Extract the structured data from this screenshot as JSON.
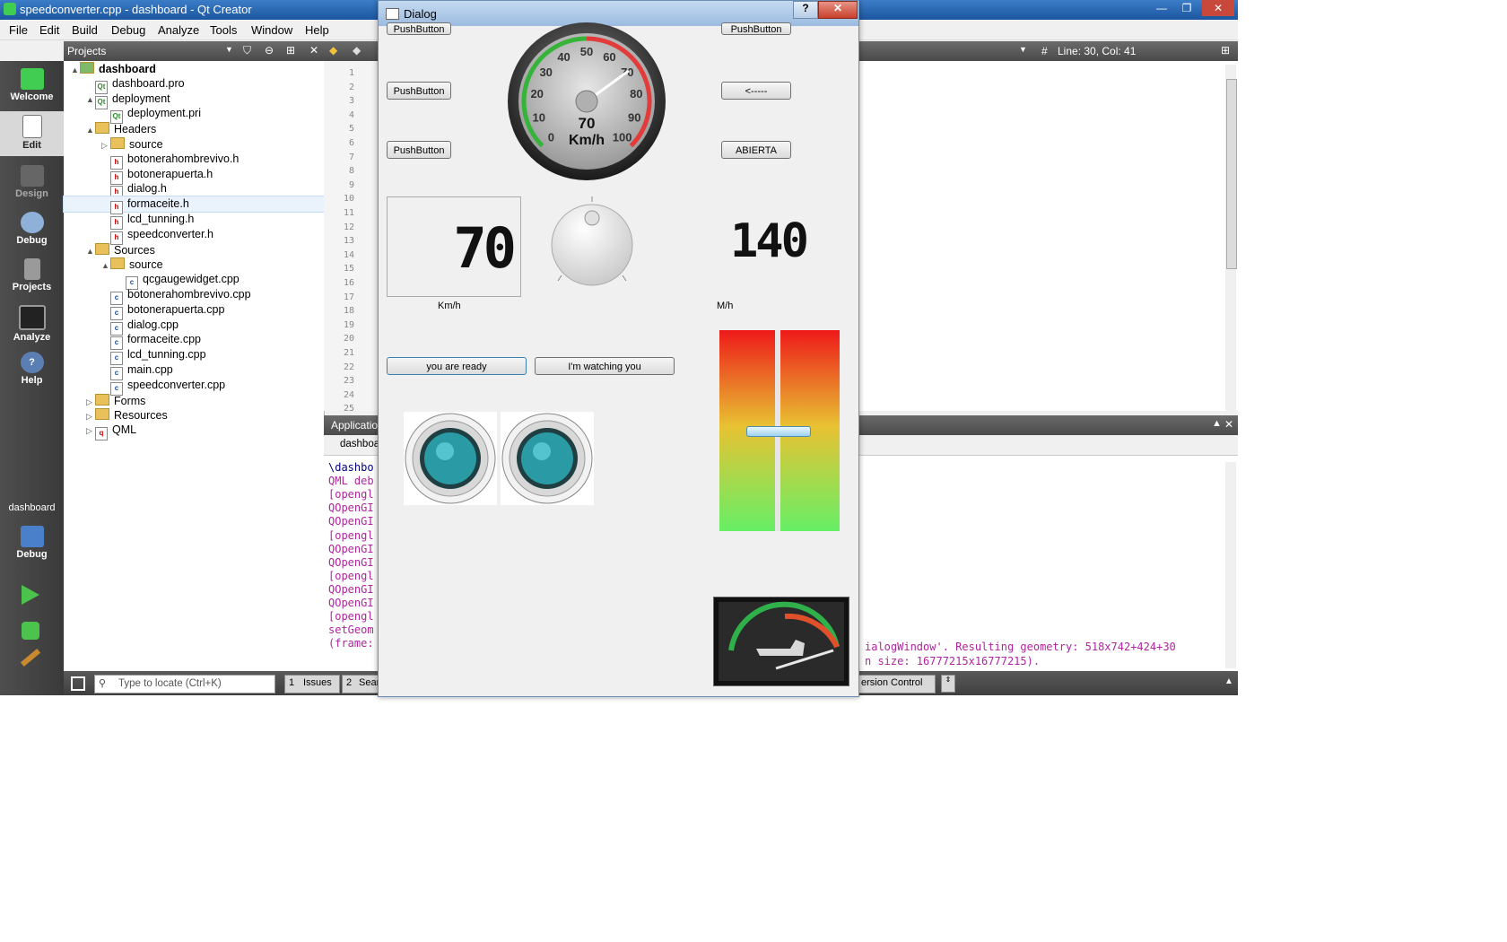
{
  "qt": {
    "title": "speedconverter.cpp - dashboard - Qt Creator",
    "menu": [
      "File",
      "Edit",
      "Build",
      "Debug",
      "Analyze",
      "Tools",
      "Window",
      "Help"
    ],
    "modes": [
      {
        "label": "Welcome",
        "icon": "qt-logo-icon"
      },
      {
        "label": "Edit",
        "icon": "edit-document-icon"
      },
      {
        "label": "Design",
        "icon": "design-pencil-icon"
      },
      {
        "label": "Debug",
        "icon": "debug-bug-icon"
      },
      {
        "label": "Projects",
        "icon": "projects-icon"
      },
      {
        "label": "Analyze",
        "icon": "analyze-monitor-icon"
      },
      {
        "label": "Help",
        "icon": "help-icon"
      }
    ],
    "kit": {
      "project": "dashboard",
      "mode": "Debug"
    },
    "projects_label": "Projects",
    "tree": [
      {
        "label": "dashboard",
        "depth": 0,
        "kind": "project",
        "bold": true,
        "arrow": "▲"
      },
      {
        "label": "dashboard.pro",
        "depth": 1,
        "kind": "pro",
        "arrow": ""
      },
      {
        "label": "deployment",
        "depth": 1,
        "kind": "pro",
        "arrow": "▲"
      },
      {
        "label": "deployment.pri",
        "depth": 2,
        "kind": "pro",
        "arrow": ""
      },
      {
        "label": "Headers",
        "depth": 1,
        "kind": "folder-h",
        "arrow": "▲"
      },
      {
        "label": "source",
        "depth": 2,
        "kind": "folder",
        "arrow": "▷"
      },
      {
        "label": "botonerahombrevivo.h",
        "depth": 2,
        "kind": "h",
        "arrow": ""
      },
      {
        "label": "botonerapuerta.h",
        "depth": 2,
        "kind": "h",
        "arrow": ""
      },
      {
        "label": "dialog.h",
        "depth": 2,
        "kind": "h",
        "arrow": ""
      },
      {
        "label": "formaceite.h",
        "depth": 2,
        "kind": "h",
        "arrow": "",
        "selected": true
      },
      {
        "label": "lcd_tunning.h",
        "depth": 2,
        "kind": "h",
        "arrow": ""
      },
      {
        "label": "speedconverter.h",
        "depth": 2,
        "kind": "h",
        "arrow": ""
      },
      {
        "label": "Sources",
        "depth": 1,
        "kind": "folder",
        "arrow": "▲"
      },
      {
        "label": "source",
        "depth": 2,
        "kind": "folder",
        "arrow": "▲"
      },
      {
        "label": "qcgaugewidget.cpp",
        "depth": 3,
        "kind": "cpp",
        "arrow": ""
      },
      {
        "label": "botonerahombrevivo.cpp",
        "depth": 2,
        "kind": "cpp",
        "arrow": ""
      },
      {
        "label": "botonerapuerta.cpp",
        "depth": 2,
        "kind": "cpp",
        "arrow": ""
      },
      {
        "label": "dialog.cpp",
        "depth": 2,
        "kind": "cpp",
        "arrow": ""
      },
      {
        "label": "formaceite.cpp",
        "depth": 2,
        "kind": "cpp",
        "arrow": ""
      },
      {
        "label": "lcd_tunning.cpp",
        "depth": 2,
        "kind": "cpp",
        "arrow": ""
      },
      {
        "label": "main.cpp",
        "depth": 2,
        "kind": "cpp",
        "arrow": ""
      },
      {
        "label": "speedconverter.cpp",
        "depth": 2,
        "kind": "cpp",
        "arrow": ""
      },
      {
        "label": "Forms",
        "depth": 1,
        "kind": "folder",
        "arrow": "▷"
      },
      {
        "label": "Resources",
        "depth": 1,
        "kind": "folder",
        "arrow": "▷"
      },
      {
        "label": "QML",
        "depth": 1,
        "kind": "qml",
        "arrow": "▷"
      }
    ],
    "editor": {
      "cursor": "Line: 30, Col: 41",
      "hash": "#",
      "line_numbers": [
        "1",
        "2",
        "3",
        "4",
        "5",
        "6",
        "7",
        "8",
        "9",
        "10",
        "11",
        "12",
        "13",
        "14",
        "15",
        "16",
        "17",
        "18",
        "19",
        "20",
        "21",
        "22",
        "23",
        "24",
        "25"
      ]
    },
    "output": {
      "pane_title": "Application",
      "tab": "dashboard",
      "lines": [
        {
          "text": "\\dashbo",
          "color": "#000080"
        },
        {
          "text": "QML deb",
          "color": "#b0249f"
        },
        {
          "text": "[opengl",
          "color": "#b0249f"
        },
        {
          "text": "QOpenGI",
          "color": "#b0249f"
        },
        {
          "text": "QOpenGI",
          "color": "#b0249f"
        },
        {
          "text": "[opengl",
          "color": "#b0249f"
        },
        {
          "text": "QOpenGI",
          "color": "#b0249f"
        },
        {
          "text": "QOpenGI",
          "color": "#b0249f"
        },
        {
          "text": "[opengl",
          "color": "#b0249f"
        },
        {
          "text": "QOpenGI",
          "color": "#b0249f"
        },
        {
          "text": "QOpenGI",
          "color": "#b0249f"
        },
        {
          "text": "[opengl",
          "color": "#b0249f"
        },
        {
          "text": "setGeom",
          "color": "#b0249f"
        },
        {
          "text": "(frame:",
          "color": "#b0249f"
        }
      ],
      "right_line1": "ialogWindow'. Resulting geometry:  518x742+424+30",
      "right_line2": "n size: 16777215x16777215)."
    },
    "status": {
      "locator_placeholder": "Type to locate (Ctrl+K)",
      "tabs": [
        {
          "num": "1",
          "label": "Issues"
        },
        {
          "num": "2",
          "label": "Sear"
        }
      ],
      "right_tab": "ersion Control"
    }
  },
  "dialog": {
    "title": "Dialog",
    "help_btn": "?",
    "close_btn": "✕",
    "buttons_left": [
      "PushButton",
      "PushButton",
      "PushButton"
    ],
    "buttons_right": [
      "PushButton",
      "<-----",
      "ABIERTA"
    ],
    "gauge": {
      "value": 70,
      "unit": "Km/h",
      "ticks": [
        "0",
        "10",
        "20",
        "30",
        "40",
        "50",
        "60",
        "70",
        "80",
        "90",
        "100"
      ]
    },
    "lcd_kmh": "70",
    "lcd_mph": "140",
    "label_kmh": "Km/h",
    "label_mph": "M/h",
    "btn_ready": "you are ready",
    "btn_watching": "I'm  watching you",
    "slider_level": 0.5
  }
}
